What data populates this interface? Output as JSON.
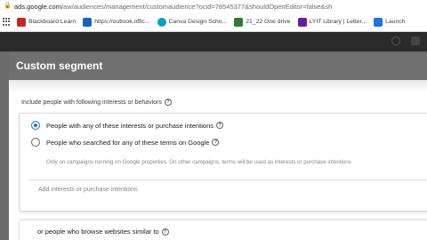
{
  "browser": {
    "url_host": "ads.google.com",
    "url_path": "/aw/audiences/management/customaudience?ocid=76545377&shouldOpenEditor=false&sh"
  },
  "bookmarks": [
    {
      "label": "Blackboard Learn",
      "icon": "blackboard-icon",
      "color": "#c62828"
    },
    {
      "label": "https://outlook.offic...",
      "icon": "outlook-icon",
      "color": "#1565c0"
    },
    {
      "label": "Canva Design Scho...",
      "icon": "canva-icon",
      "color": "#00a3c4"
    },
    {
      "label": "21_22 One drive",
      "icon": "onedrive-icon",
      "color": "#2e7d32"
    },
    {
      "label": "LYIT Library | Letter...",
      "icon": "library-icon",
      "color": "#6a1b9a"
    },
    {
      "label": "Launch",
      "icon": "launch-icon",
      "color": "#1a73e8"
    }
  ],
  "modal": {
    "title": "Custom segment",
    "section_label": "Include people with following interests or behaviors",
    "options": [
      {
        "label": "People with any of these interests or purchase intentions",
        "selected": true
      },
      {
        "label": "People who searched for any of these terms on Google",
        "selected": false
      }
    ],
    "search_note": "Only on campaigns running on Google properties. On other campaigns, terms will be used as interests or purchase intentions",
    "add_placeholder": "Add interests or purchase intentions",
    "browse_label": "or people who browse websites similar to"
  },
  "colors": {
    "accent": "#1a73e8",
    "modal_header": "#707070"
  }
}
